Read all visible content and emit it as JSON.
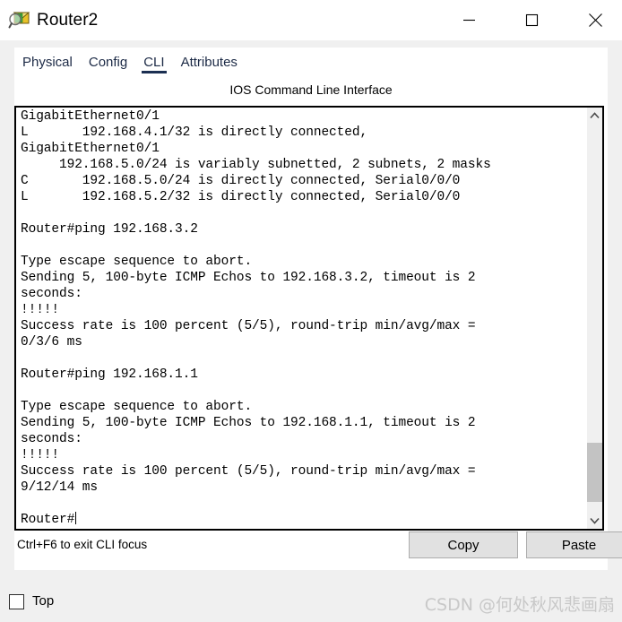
{
  "window": {
    "title": "Router2",
    "icon": "envelope-magnifier-icon",
    "controls": {
      "minimize": "minimize-icon",
      "maximize": "maximize-icon",
      "close": "close-icon"
    }
  },
  "tabs": [
    {
      "label": "Physical",
      "active": false
    },
    {
      "label": "Config",
      "active": false
    },
    {
      "label": "CLI",
      "active": true
    },
    {
      "label": "Attributes",
      "active": false
    }
  ],
  "panel": {
    "title": "IOS Command Line Interface",
    "hint": "Ctrl+F6 to exit CLI focus",
    "copy_label": "Copy",
    "paste_label": "Paste"
  },
  "terminal": {
    "lines": [
      "GigabitEthernet0/1",
      "L       192.168.4.1/32 is directly connected,",
      "GigabitEthernet0/1",
      "     192.168.5.0/24 is variably subnetted, 2 subnets, 2 masks",
      "C       192.168.5.0/24 is directly connected, Serial0/0/0",
      "L       192.168.5.2/32 is directly connected, Serial0/0/0",
      "",
      "Router#ping 192.168.3.2",
      "",
      "Type escape sequence to abort.",
      "Sending 5, 100-byte ICMP Echos to 192.168.3.2, timeout is 2",
      "seconds:",
      "!!!!!",
      "Success rate is 100 percent (5/5), round-trip min/avg/max =",
      "0/3/6 ms",
      "",
      "Router#ping 192.168.1.1",
      "",
      "Type escape sequence to abort.",
      "Sending 5, 100-byte ICMP Echos to 192.168.1.1, timeout is 2",
      "seconds:",
      "!!!!!",
      "Success rate is 100 percent (5/5), round-trip min/avg/max =",
      "9/12/14 ms",
      ""
    ],
    "prompt": "Router#"
  },
  "scrollbar": {
    "up_icon": "chevron-up-icon",
    "down_icon": "chevron-down-icon"
  },
  "bottom": {
    "top_checkbox_label": "Top",
    "top_checkbox_checked": false,
    "watermark": "CSDN @何处秋风悲画扇"
  },
  "colors": {
    "accent": "#1b2f52",
    "button_face": "#e1e1e1",
    "window_bg": "#f0f0f0",
    "scroll_thumb": "#c3c3c3",
    "watermark": "#c8c8c8"
  }
}
